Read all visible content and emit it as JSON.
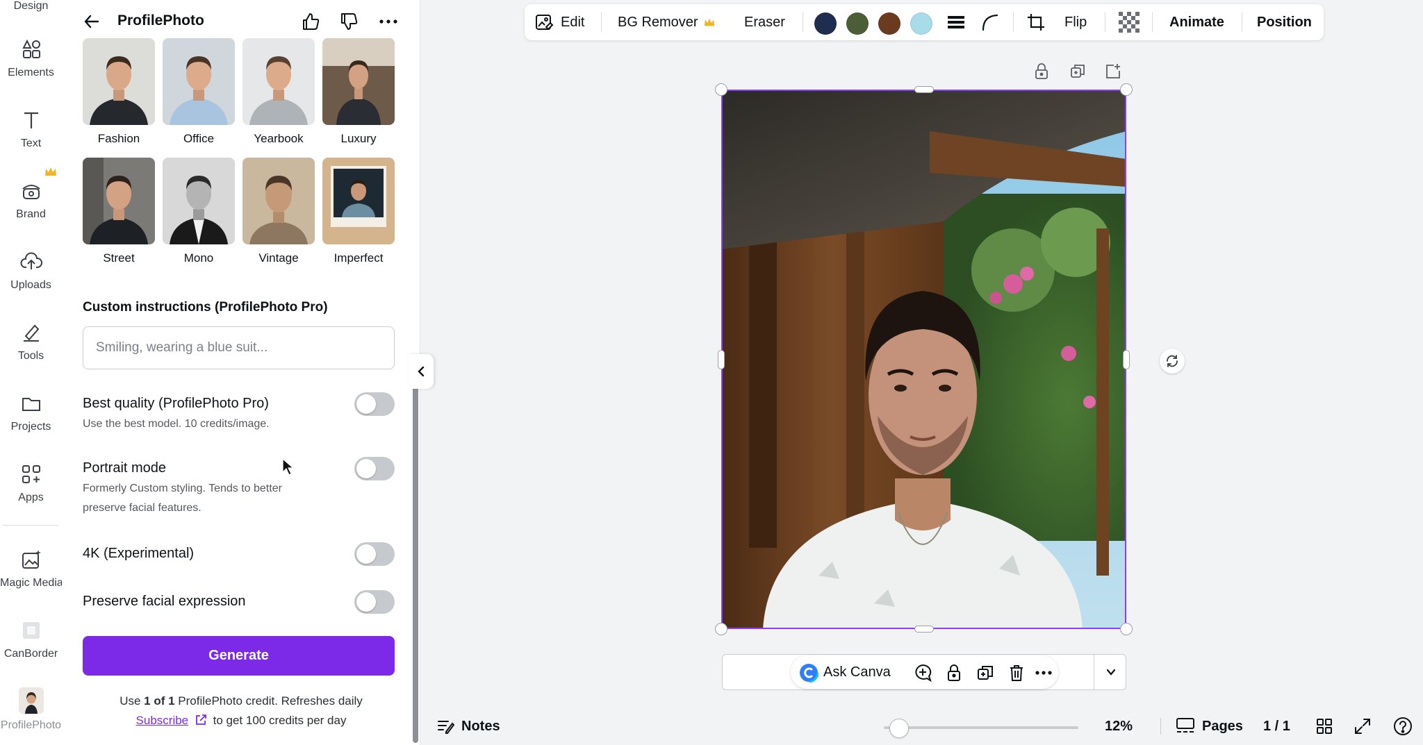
{
  "rail": {
    "top_partial": "Design",
    "items": [
      {
        "label": "Elements",
        "icon": "elements-icon"
      },
      {
        "label": "Text",
        "icon": "text-icon"
      },
      {
        "label": "Brand",
        "icon": "brand-icon"
      },
      {
        "label": "Uploads",
        "icon": "uploads-icon"
      },
      {
        "label": "Tools",
        "icon": "tools-icon"
      },
      {
        "label": "Projects",
        "icon": "projects-icon"
      },
      {
        "label": "Apps",
        "icon": "apps-icon"
      },
      {
        "label": "Magic Media",
        "icon": "magic-media-icon"
      },
      {
        "label": "CanBorder",
        "icon": "canborder-icon"
      },
      {
        "label": "ProfilePhoto",
        "icon": "profilephoto-app-icon"
      }
    ]
  },
  "panel": {
    "title": "ProfilePhoto",
    "styles": [
      "Fashion",
      "Office",
      "Yearbook",
      "Luxury",
      "Street",
      "Mono",
      "Vintage",
      "Imperfect"
    ],
    "custom_title": "Custom instructions (ProfilePhoto Pro)",
    "custom_placeholder": "Smiling, wearing a blue suit...",
    "options": [
      {
        "title": "Best quality (ProfilePhoto Pro)",
        "desc": "Use the best model. 10 credits/image.",
        "on": false
      },
      {
        "title": "Portrait mode",
        "desc": "Formerly Custom styling. Tends to better preserve facial features.",
        "on": false
      },
      {
        "title": "4K (Experimental)",
        "desc": "",
        "on": false
      },
      {
        "title": "Preserve facial expression",
        "desc": "",
        "on": false
      }
    ],
    "generate_label": "Generate",
    "credit_pre": "Use ",
    "credit_bold": "1 of 1",
    "credit_post": " ProfilePhoto credit. Refreshes daily",
    "subscribe_label": "Subscribe",
    "subscribe_post": "to get 100 credits per day"
  },
  "toolbar": {
    "edit": "Edit",
    "bg_remover": "BG Remover",
    "eraser": "Eraser",
    "colors": [
      "#1f2d4f",
      "#4b5e37",
      "#6b3a1f",
      "#a8dce8"
    ],
    "flip": "Flip",
    "animate": "Animate",
    "position": "Position"
  },
  "canvas": {
    "ask_canva": "Ask Canva"
  },
  "bottom": {
    "notes": "Notes",
    "zoom": "12%",
    "pages": "Pages",
    "page_count": "1 / 1"
  },
  "colors": {
    "accent": "#7d2ae8",
    "selection": "#8b3dff"
  }
}
